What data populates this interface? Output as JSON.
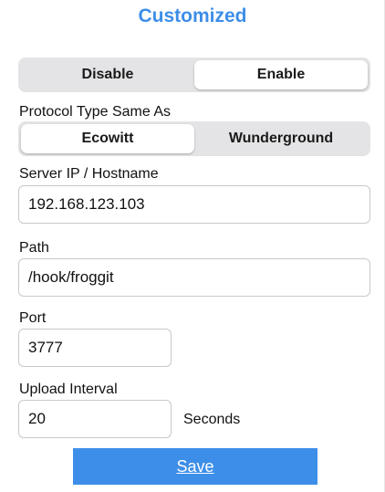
{
  "title": "Customized",
  "state_toggle": {
    "options": [
      "Disable",
      "Enable"
    ],
    "selected": "Enable"
  },
  "protocol": {
    "label": "Protocol Type Same As",
    "options": [
      "Ecowitt",
      "Wunderground"
    ],
    "selected": "Ecowitt"
  },
  "server": {
    "label": "Server IP / Hostname",
    "value": "192.168.123.103"
  },
  "path": {
    "label": "Path",
    "value": "/hook/froggit"
  },
  "port": {
    "label": "Port",
    "value": "3777"
  },
  "interval": {
    "label": "Upload Interval",
    "value": "20",
    "unit": "Seconds"
  },
  "save_label": "Save",
  "colors": {
    "accent": "#3d8ee8",
    "segment_bg": "#e4e4e6"
  }
}
